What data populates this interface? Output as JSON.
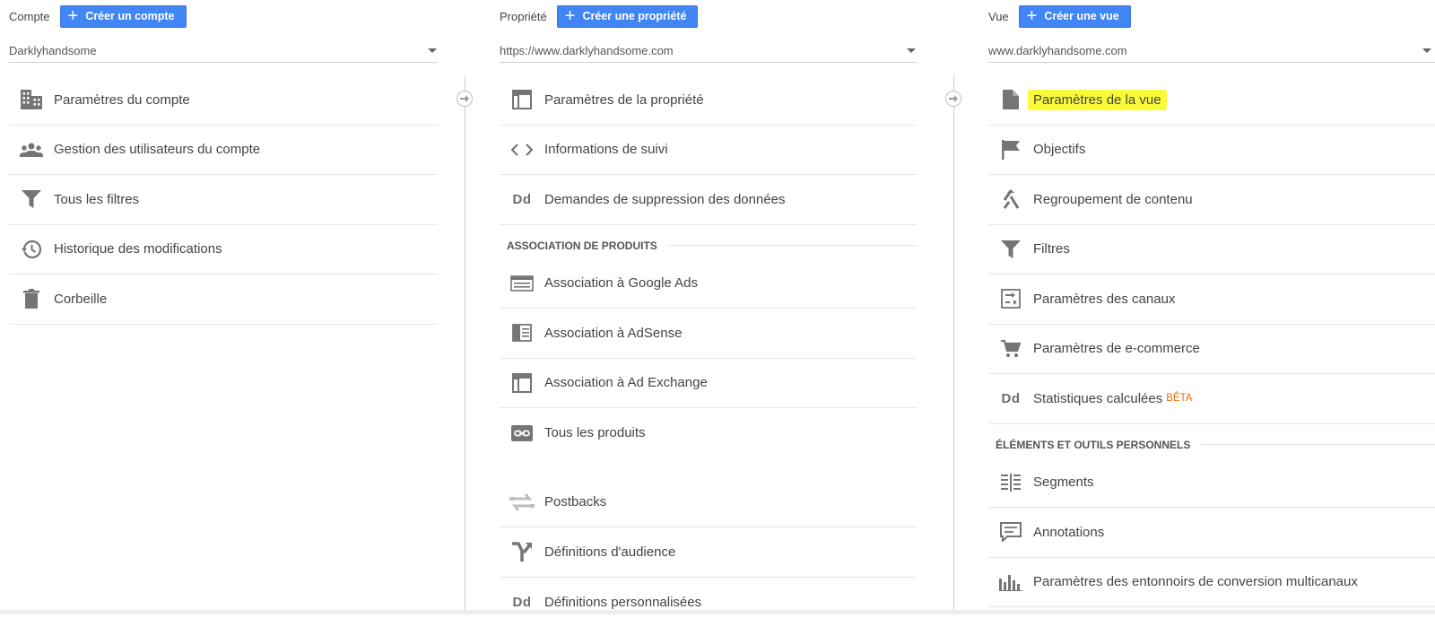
{
  "account": {
    "label": "Compte",
    "create_label": "Créer un compte",
    "selected": "Darklyhandsome",
    "items": [
      {
        "label": "Paramètres du compte",
        "icon": "building-icon"
      },
      {
        "label": "Gestion des utilisateurs du compte",
        "icon": "people-icon"
      },
      {
        "label": "Tous les filtres",
        "icon": "filter-icon"
      },
      {
        "label": "Historique des modifications",
        "icon": "history-icon"
      },
      {
        "label": "Corbeille",
        "icon": "trash-icon"
      }
    ]
  },
  "property": {
    "label": "Propriété",
    "create_label": "Créer une propriété",
    "selected": "https://www.darklyhandsome.com",
    "items": [
      {
        "label": "Paramètres de la propriété",
        "icon": "layout-icon"
      },
      {
        "label": "Informations de suivi",
        "icon": "code-icon"
      },
      {
        "label": "Demandes de suppression des données",
        "icon": "dd-icon"
      }
    ],
    "section_title": "ASSOCIATION DE PRODUITS",
    "product_items": [
      {
        "label": "Association à Google Ads",
        "icon": "ads-icon"
      },
      {
        "label": "Association à AdSense",
        "icon": "adsense-icon"
      },
      {
        "label": "Association à Ad Exchange",
        "icon": "layout-icon"
      },
      {
        "label": "Tous les produits",
        "icon": "link-icon"
      }
    ],
    "extra_items": [
      {
        "label": "Postbacks",
        "icon": "swap-icon"
      },
      {
        "label": "Définitions d'audience",
        "icon": "fork-icon"
      },
      {
        "label": "Définitions personnalisées",
        "icon": "dd-icon"
      }
    ]
  },
  "view": {
    "label": "Vue",
    "create_label": "Créer une vue",
    "selected": "www.darklyhandsome.com",
    "items": [
      {
        "label": "Paramètres de la vue",
        "icon": "document-icon"
      },
      {
        "label": "Objectifs",
        "icon": "flag-icon"
      },
      {
        "label": "Regroupement de contenu",
        "icon": "merge-icon"
      },
      {
        "label": "Filtres",
        "icon": "filter-icon"
      },
      {
        "label": "Paramètres des canaux",
        "icon": "channels-icon"
      },
      {
        "label": "Paramètres de e-commerce",
        "icon": "cart-icon"
      },
      {
        "label": "Statistiques calculées",
        "icon": "dd-icon",
        "badge": "BÊTA"
      }
    ],
    "section_title": "ÉLÉMENTS ET OUTILS PERSONNELS",
    "personal_items": [
      {
        "label": "Segments",
        "icon": "segments-icon"
      },
      {
        "label": "Annotations",
        "icon": "comment-icon"
      },
      {
        "label": "Paramètres des entonnoirs de conversion multicanaux",
        "icon": "bars-icon"
      }
    ]
  },
  "colors": {
    "accent": "#4285f4",
    "highlight": "#fafa38",
    "beta": "#e8710a"
  }
}
